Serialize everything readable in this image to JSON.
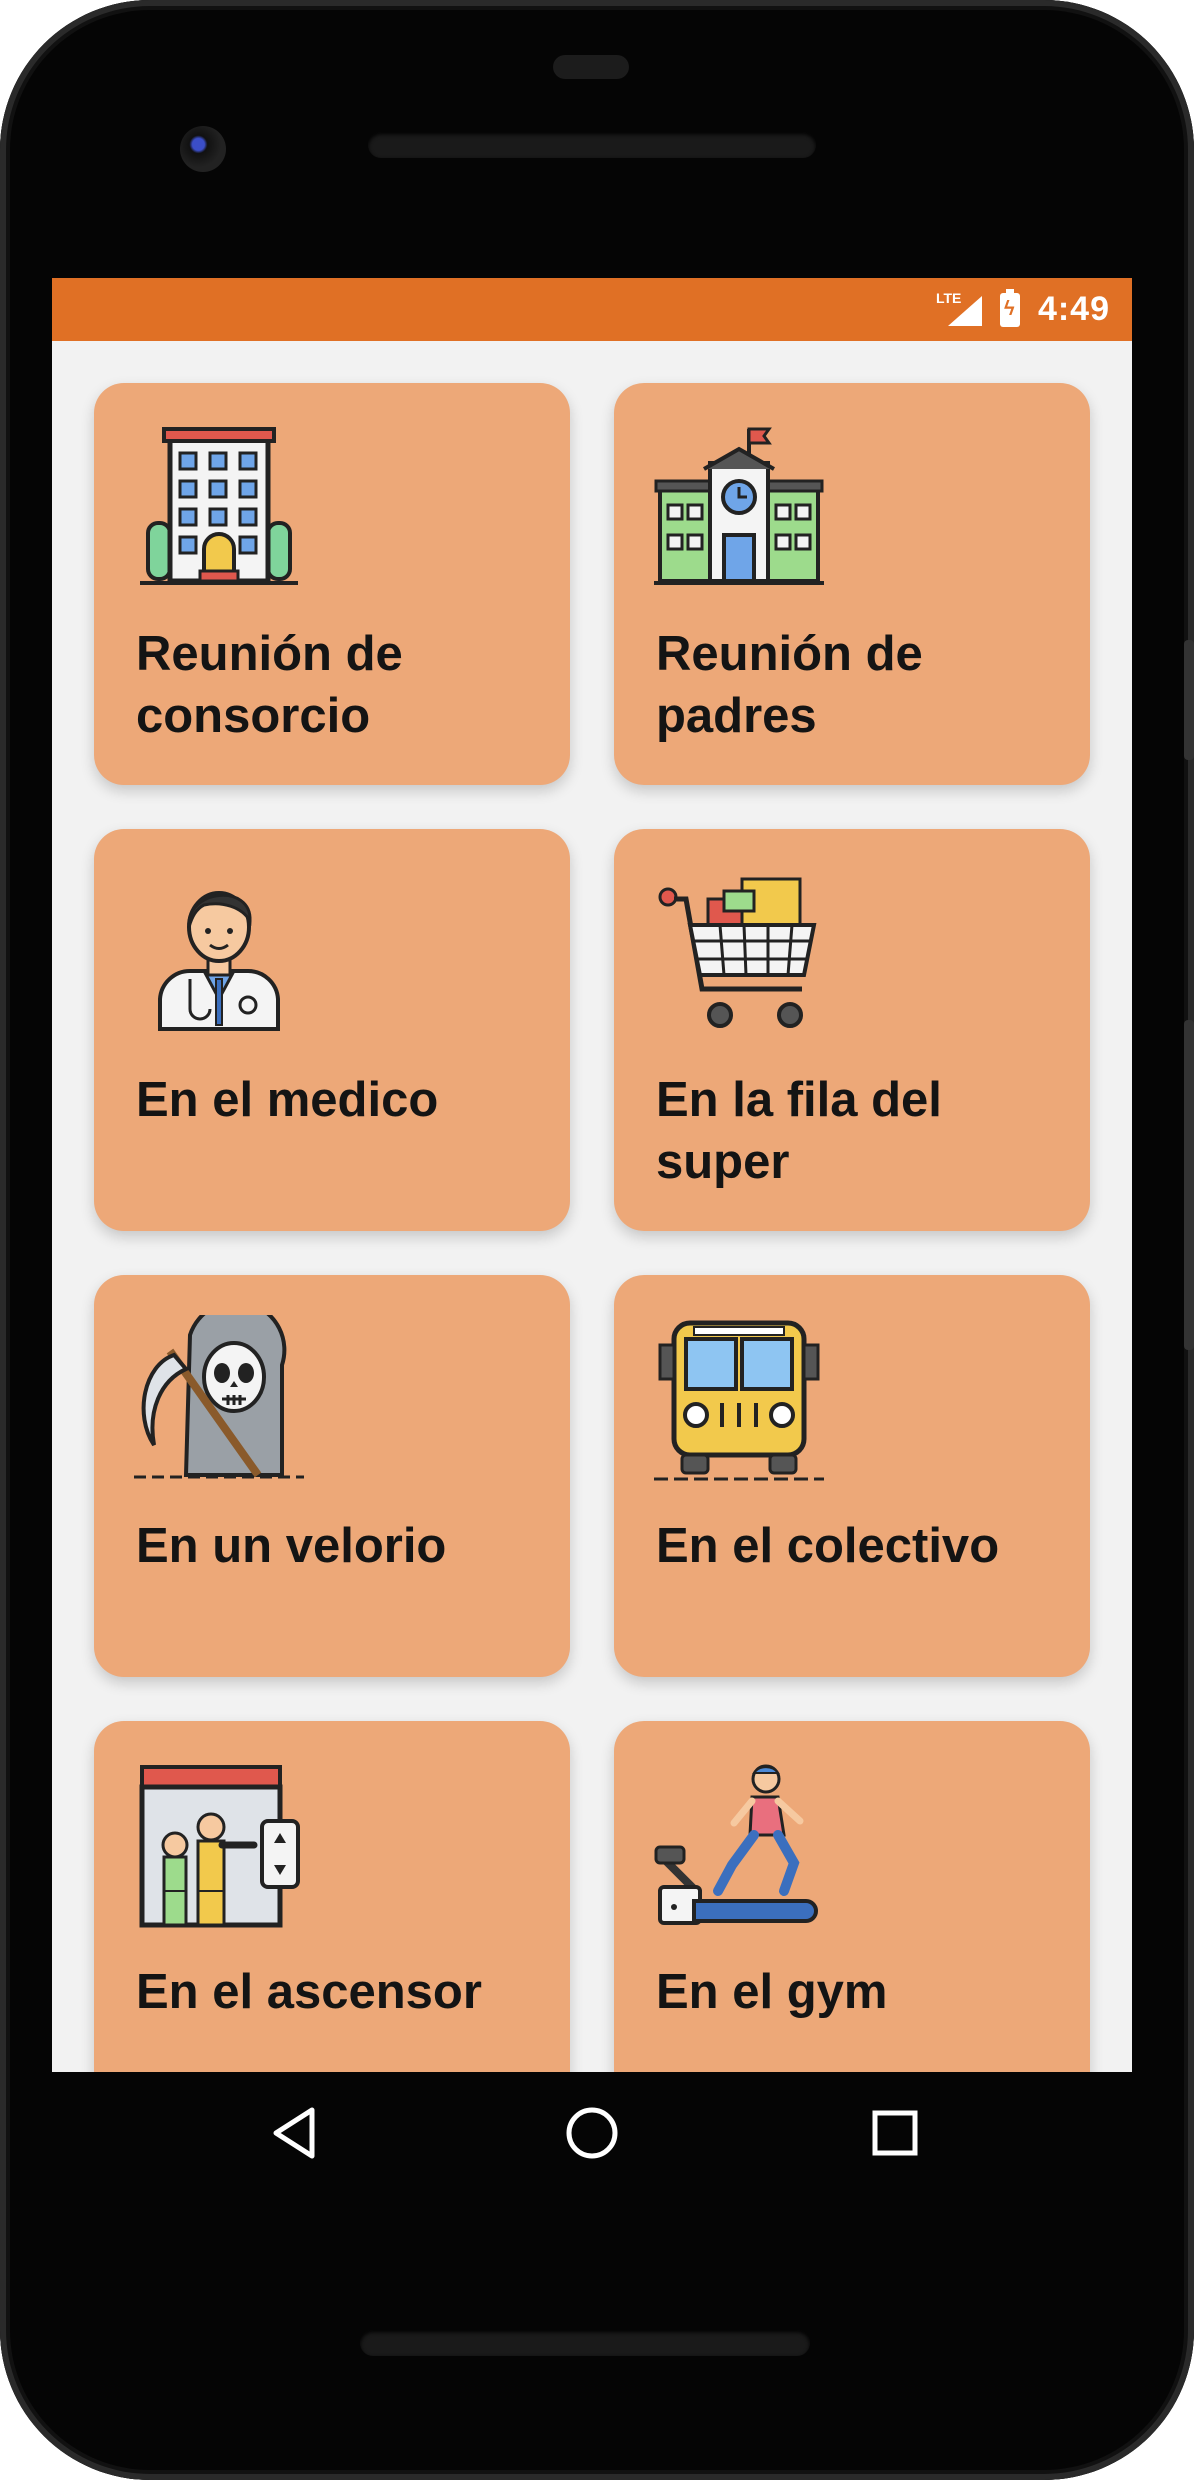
{
  "status_bar": {
    "network": "LTE",
    "time": "4:49",
    "color": "#e07025"
  },
  "cards": [
    {
      "label": "Reunión de consorcio",
      "icon": "apartment-building-icon"
    },
    {
      "label": "Reunión de padres",
      "icon": "school-building-icon"
    },
    {
      "label": "En el medico",
      "icon": "doctor-icon"
    },
    {
      "label": "En la fila del super",
      "icon": "shopping-cart-icon"
    },
    {
      "label": "En un velorio",
      "icon": "grim-reaper-icon"
    },
    {
      "label": "En el colectivo",
      "icon": "bus-icon"
    },
    {
      "label": "En el ascensor",
      "icon": "elevator-icon"
    },
    {
      "label": "En el gym",
      "icon": "treadmill-icon"
    }
  ],
  "nav": {
    "back": "back-icon",
    "home": "home-icon",
    "recents": "recents-icon"
  },
  "colors": {
    "card": "#eda878",
    "accent": "#e07025",
    "background": "#f2f2f2"
  }
}
